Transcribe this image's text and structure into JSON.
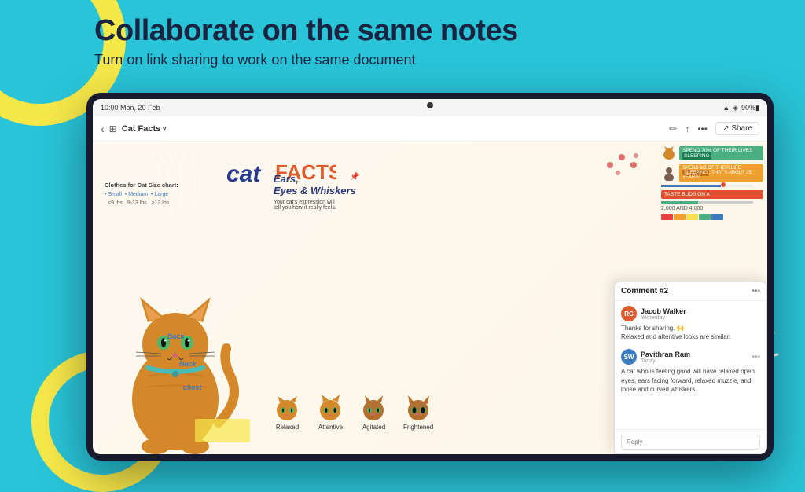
{
  "page": {
    "background_color": "#29c4d8"
  },
  "header": {
    "main_title": "Collaborate on the same notes",
    "sub_title": "Turn on link sharing to work on the same document"
  },
  "status_bar": {
    "time": "10:00",
    "date": "Mon, 20 Feb",
    "battery": "90%",
    "signal_icon": "▲▲▲"
  },
  "toolbar": {
    "back_icon": "‹",
    "grid_icon": "⊞",
    "title": "Cat Facts",
    "title_arrow": "∨",
    "edit_icon": "✏",
    "export_icon": "↑",
    "more_icon": "•••",
    "share_icon": "↗",
    "share_label": "Share"
  },
  "note": {
    "title": "Cat FACTS",
    "cat_title_part1": "Cat",
    "cat_title_part2": "FACTS",
    "info_label": {
      "size_chart_title": "Clothes for Cat Size chart:",
      "size_small": "• Small",
      "size_medium": "• Medium",
      "size_large": "• Large",
      "size_small_range": "<9 lbs",
      "size_medium_range": "9-13 lbs",
      "size_large_range": ">13 lbs"
    },
    "ears_section": {
      "title": "Ears,",
      "title2": "Eyes & Whiskers",
      "desc": "Your cat's expression will\ntell you how it really feels."
    },
    "cat_faces": [
      {
        "label": "Relaxed"
      },
      {
        "label": "Attentive"
      },
      {
        "label": "Agitated"
      },
      {
        "label": "Frightened"
      }
    ],
    "body_parts": [
      "Back",
      "Neck",
      "Chest"
    ],
    "right_bars": [
      {
        "text": "SPEND 70% OF THEIR LIVES SLEEPING",
        "color": "green"
      },
      {
        "text": "SPEND 1/3 OF THEIR LIFE SLEEPING, THAT'S ABOUT 25 YEARS!",
        "color": "orange"
      },
      {
        "text": "TASTE BUDS ON A",
        "color": "red"
      },
      {
        "text": "2,000 AND 4,000",
        "color": "green2"
      }
    ]
  },
  "comments": {
    "title": "Comment #2",
    "more_icon": "•••",
    "items": [
      {
        "avatar_initials": "RC",
        "avatar_color": "rc",
        "username": "Jacob Walker",
        "time": "Yesterday",
        "text": "Thanks for sharing. 🙌\nRelaxed and attentive looks are similar.",
        "more_icon": ""
      },
      {
        "avatar_initials": "SW",
        "avatar_color": "sw",
        "username": "Pavithran Ram",
        "time": "Today",
        "text": "A cat who is feeling good will have relaxed open eyes, ears facing forward, relaxed muzzle, and loose and curved whiskers.",
        "more_icon": "•••"
      }
    ],
    "reply_placeholder": "Reply"
  }
}
